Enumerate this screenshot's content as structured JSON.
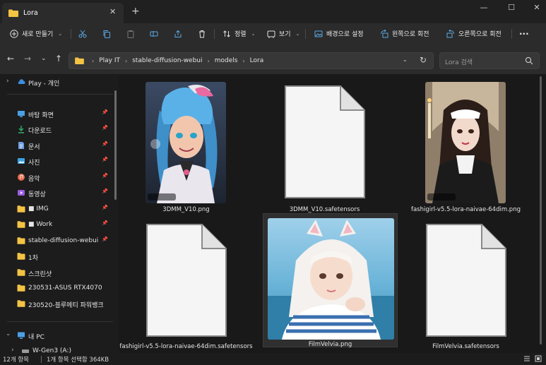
{
  "window": {
    "tab_title": "Lora",
    "tab_close": "✕",
    "new_tab": "+",
    "controls": [
      "—",
      "☐",
      "✕"
    ]
  },
  "toolbar": {
    "new_label": "새로 만들기",
    "sort_label": "정렬",
    "view_label": "보기",
    "wallpaper_label": "배경으로 설정",
    "rotate_left_label": "왼쪽으로 회전",
    "rotate_right_label": "오른쪽으로 회전",
    "more_label": "···"
  },
  "address": {
    "crumbs": [
      "Play IT",
      "stable-diffusion-webui",
      "models",
      "Lora"
    ],
    "search_placeholder": "Lora 검색"
  },
  "sidebar": {
    "cloud": "Play - 개인",
    "items": [
      {
        "label": "바탕 화면",
        "icon": "desktop-icon",
        "pinned": true
      },
      {
        "label": "다운로드",
        "icon": "download-icon",
        "pinned": true
      },
      {
        "label": "문서",
        "icon": "document-icon",
        "pinned": true
      },
      {
        "label": "사진",
        "icon": "pictures-icon",
        "pinned": true
      },
      {
        "label": "음악",
        "icon": "music-icon",
        "pinned": true
      },
      {
        "label": "동영상",
        "icon": "video-icon",
        "pinned": true
      },
      {
        "label": "■ IMG",
        "icon": "folder-icon",
        "pinned": true
      },
      {
        "label": "■ Work",
        "icon": "folder-icon",
        "pinned": true
      },
      {
        "label": "stable-diffusion-webui",
        "icon": "folder-icon",
        "pinned": true
      },
      {
        "label": "1차",
        "icon": "folder-icon",
        "pinned": false
      },
      {
        "label": "스크린샷",
        "icon": "folder-icon",
        "pinned": false
      },
      {
        "label": "230531-ASUS RTX4070",
        "icon": "folder-icon",
        "pinned": false
      },
      {
        "label": "230520-블루메티 파워뱅크",
        "icon": "folder-icon",
        "pinned": false
      }
    ],
    "this_pc": "내 PC",
    "drive": "W-Gen3 (A:)"
  },
  "files": [
    {
      "name": "3DMM_V10.png",
      "type": "image"
    },
    {
      "name": "3DMM_V10.safetensors",
      "type": "doc"
    },
    {
      "name": "fashigirl-v5.5-lora-naivae-64dim.png",
      "type": "image"
    },
    {
      "name": "fashigirl-v5.5-lora-naivae-64dim.safetensors",
      "type": "doc"
    },
    {
      "name": "FilmVelvia.png",
      "type": "image",
      "selected": true
    },
    {
      "name": "FilmVelvia.safetensors",
      "type": "doc"
    }
  ],
  "status": {
    "count": "12개 항목",
    "selection": "1개 항목 선택함 364KB"
  },
  "colors": {
    "folder": "#f3c344",
    "accent": "#4aa0e6"
  }
}
